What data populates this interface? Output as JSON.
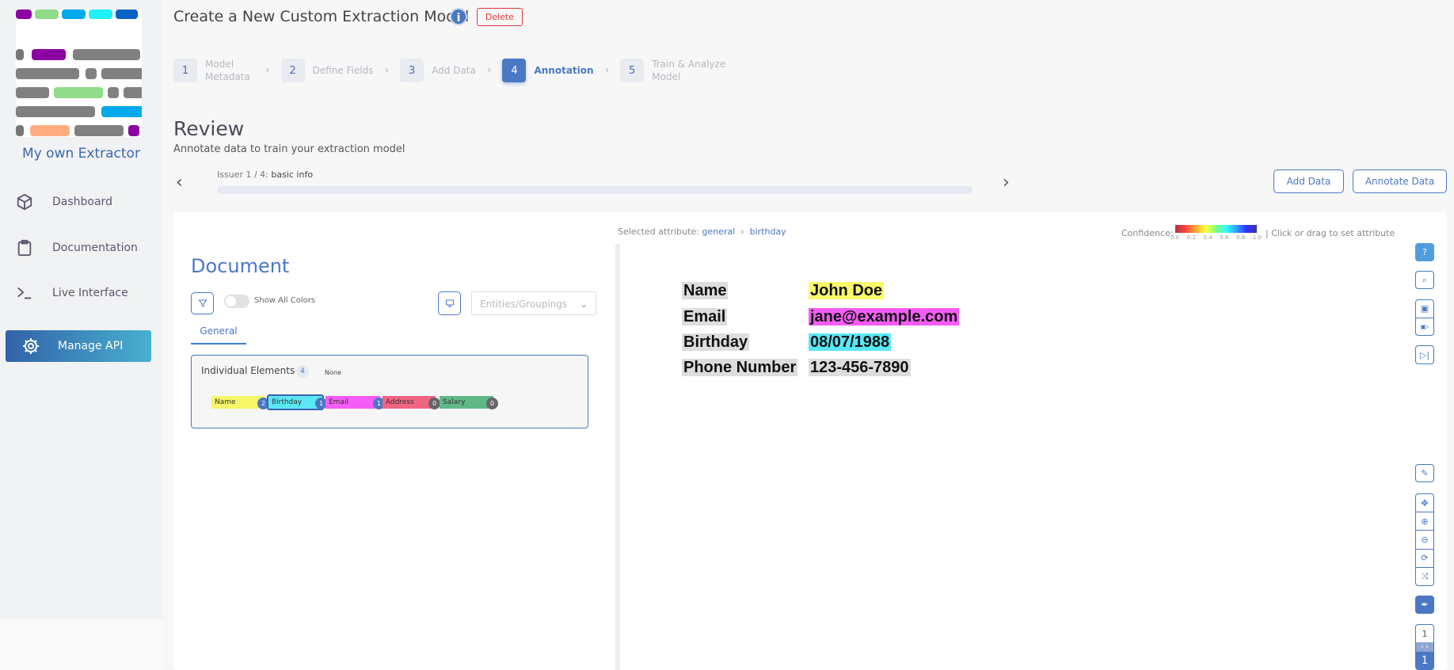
{
  "sidebar": {
    "brand": "My own Extractor",
    "items": [
      {
        "label": "Dashboard",
        "icon": "cube-icon"
      },
      {
        "label": "Documentation",
        "icon": "clipboard-icon"
      },
      {
        "label": "Live Interface",
        "icon": "terminal-icon"
      },
      {
        "label": "Manage API",
        "icon": "gear-icon",
        "active": true
      }
    ]
  },
  "header": {
    "title": "Create a New Custom Extraction Model",
    "delete_label": "Delete"
  },
  "steps": [
    {
      "n": "1",
      "label": "Model Metadata"
    },
    {
      "n": "2",
      "label": "Define Fields"
    },
    {
      "n": "3",
      "label": "Add Data"
    },
    {
      "n": "4",
      "label": "Annotation",
      "active": true
    },
    {
      "n": "5",
      "label": "Train & Analyze Model"
    }
  ],
  "review": {
    "title": "Review",
    "subtitle": "Annotate data to train your extraction model",
    "issuer_prefix": "Issuer 1 / 4:",
    "issuer_name": "basic info",
    "progress": 0.0,
    "add_data": "Add Data",
    "annotate_data": "Annotate Data"
  },
  "document": {
    "heading": "Document",
    "show_all_colors": "Show All Colors",
    "select_placeholder": "Entities/Groupings",
    "tab": "General",
    "group_title": "Individual Elements",
    "group_count": "4",
    "none_label": "None",
    "chips": [
      {
        "label": "Name",
        "count": "2",
        "color": "#f7f76a"
      },
      {
        "label": "Birthday",
        "count": "1",
        "color": "#5ae8f5",
        "selected": true
      },
      {
        "label": "Email",
        "count": "1",
        "color": "#f55cf5"
      },
      {
        "label": "Address",
        "count": "0",
        "color": "#f06682"
      },
      {
        "label": "Salary",
        "count": "0",
        "color": "#5fb987"
      }
    ]
  },
  "viewer": {
    "selected_prefix": "Selected attribute:",
    "selected_group": "general",
    "selected_attr": "birthday",
    "confidence_label": "Confidence:",
    "confidence_ticks": [
      "0.0",
      "0.2",
      "0.4",
      "0.6",
      "0.8",
      "1.0"
    ],
    "hint": "| Click or drag to set attribute",
    "rows": [
      {
        "key": "Name",
        "value": "John Doe",
        "color": "#f9f96a"
      },
      {
        "key": "Email",
        "value": "jane@example.com",
        "color": "#f55cf5"
      },
      {
        "key": "Birthday",
        "value": "08/07/1988",
        "color": "#5ae8f5"
      },
      {
        "key": "Phone Number",
        "value": "123-456-7890",
        "color": "#dddddd"
      }
    ],
    "page_current": "1",
    "page_total": "1"
  }
}
